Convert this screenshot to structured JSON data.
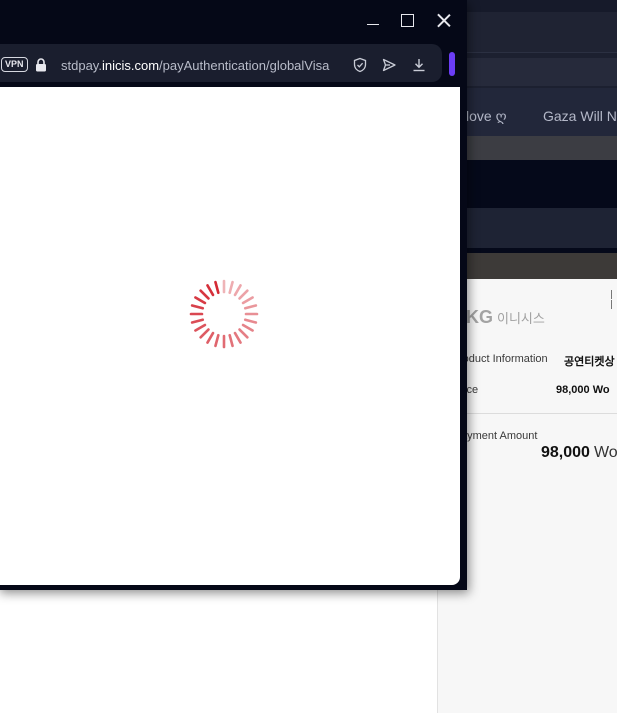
{
  "background_page": {
    "bookmarks": [
      {
        "label": "love ღ"
      },
      {
        "label": "Gaza Will N"
      }
    ],
    "payment_panel": {
      "logo_text": "KG",
      "logo_sub": "이니시스",
      "product_label": "roduct Information",
      "product_value": "공연티켓상",
      "price_label": "ice",
      "price_value": "98,000 Wo",
      "amount_label": "ayment Amount",
      "amount_value": "98,000",
      "amount_unit": "Wo"
    }
  },
  "popup": {
    "vpn_label": "VPN",
    "url_prefix": "stdpay.",
    "url_domain": "inicis.com",
    "url_path": "/payAuthentication/globalVisa",
    "loading": true
  },
  "colors": {
    "accent": "#6b3df5",
    "spinner": "#d42a35",
    "window_bg": "#050817",
    "field_bg": "#1a1e2e"
  }
}
